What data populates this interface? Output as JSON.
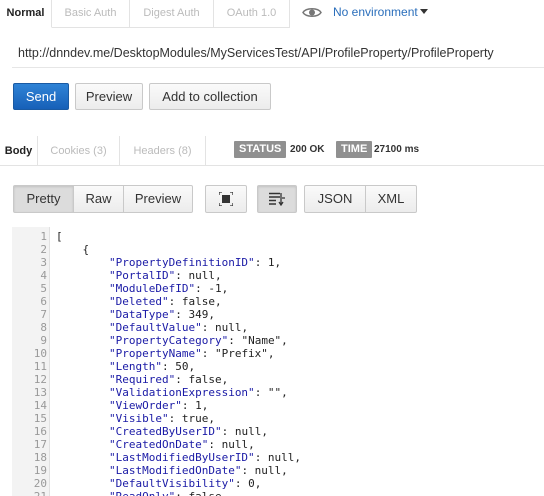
{
  "auth_tabs": [
    {
      "label": "Normal",
      "active": true
    },
    {
      "label": "Basic Auth",
      "active": false
    },
    {
      "label": "Digest Auth",
      "active": false
    },
    {
      "label": "OAuth 1.0",
      "active": false
    }
  ],
  "environment": {
    "label": "No environment",
    "icon": "eye-icon"
  },
  "url": "http://dnndev.me/DesktopModules/MyServicesTest/API/ProfileProperty/ProfileProperty",
  "actions": {
    "send": "Send",
    "preview": "Preview",
    "add": "Add to collection"
  },
  "response_tabs": [
    {
      "label": "Body",
      "active": true
    },
    {
      "label": "Cookies (3)",
      "active": false
    },
    {
      "label": "Headers (8)",
      "active": false
    }
  ],
  "status": {
    "label": "STATUS",
    "value": "200 OK"
  },
  "time": {
    "label": "TIME",
    "value": "27100 ms"
  },
  "view_modes": [
    "Pretty",
    "Raw",
    "Preview"
  ],
  "formats": [
    "JSON",
    "XML"
  ],
  "toolbar_icons": [
    "expand-icon",
    "wrap-lines-icon"
  ],
  "code_lines": [
    [
      "[",
      "",
      ""
    ],
    [
      "    {",
      "",
      ""
    ],
    [
      "        ",
      "\"PropertyDefinitionID\"",
      ": 1,"
    ],
    [
      "        ",
      "\"PortalID\"",
      ": null,"
    ],
    [
      "        ",
      "\"ModuleDefID\"",
      ": -1,"
    ],
    [
      "        ",
      "\"Deleted\"",
      ": false,"
    ],
    [
      "        ",
      "\"DataType\"",
      ": 349,"
    ],
    [
      "        ",
      "\"DefaultValue\"",
      ": null,"
    ],
    [
      "        ",
      "\"PropertyCategory\"",
      ": \"Name\","
    ],
    [
      "        ",
      "\"PropertyName\"",
      ": \"Prefix\","
    ],
    [
      "        ",
      "\"Length\"",
      ": 50,"
    ],
    [
      "        ",
      "\"Required\"",
      ": false,"
    ],
    [
      "        ",
      "\"ValidationExpression\"",
      ": \"\","
    ],
    [
      "        ",
      "\"ViewOrder\"",
      ": 1,"
    ],
    [
      "        ",
      "\"Visible\"",
      ": true,"
    ],
    [
      "        ",
      "\"CreatedByUserID\"",
      ": null,"
    ],
    [
      "        ",
      "\"CreatedOnDate\"",
      ": null,"
    ],
    [
      "        ",
      "\"LastModifiedByUserID\"",
      ": null,"
    ],
    [
      "        ",
      "\"LastModifiedOnDate\"",
      ": null,"
    ],
    [
      "        ",
      "\"DefaultVisibility\"",
      ": 0,"
    ],
    [
      "        ",
      "\"ReadOnly\"",
      ": false,"
    ]
  ]
}
